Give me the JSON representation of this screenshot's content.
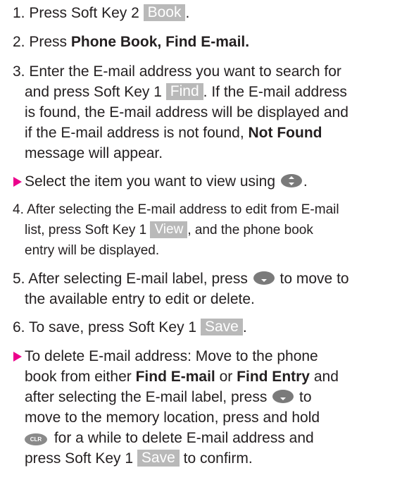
{
  "steps": {
    "s1": {
      "num": "1.",
      "pre": "Press Soft Key 2",
      "key": "Book",
      "post": "."
    },
    "s2": {
      "num": "2.",
      "pre": "Press",
      "bold": "Phone Book, Find E-mail."
    },
    "s3": {
      "num": "3.",
      "l1": "Enter the E-mail address you want to search for",
      "l2_pre": "and press Soft Key 1",
      "key": "Find",
      "l2_post": ". If the E-mail address",
      "l3": "is found, the E-mail address will be displayed and",
      "l4_pre": "if the E-mail address is not found,",
      "l4_bold": "Not Found",
      "l5": "message will appear."
    },
    "b1": {
      "text": "Select the item you want to view using",
      "icon": "navigation-up-down-icon",
      "post": "."
    },
    "s4": {
      "num": "4.",
      "l1": "After selecting the E-mail address to edit from E-mail",
      "l2_pre": "list, press Soft Key 1",
      "key": "View",
      "l2_post": ", and the phone book",
      "l3": "entry will be displayed."
    },
    "s5": {
      "num": "5.",
      "l1_pre": "After selecting E-mail label, press",
      "icon": "navigation-down-icon",
      "l1_post": "to move to",
      "l2": "the available entry to edit or delete."
    },
    "s6": {
      "num": "6.",
      "pre": "To save, press Soft Key 1",
      "key": "Save",
      "post": "."
    },
    "b2": {
      "l1": "To delete E-mail address: Move to the phone",
      "l2_pre": "book from either",
      "l2_bold1": "Find E-mail",
      "l2_mid": "or",
      "l2_bold2": "Find Entry",
      "l2_post": "and",
      "l3_pre": "after selecting the E-mail label, press",
      "l3_post": "to",
      "l4": "move to the memory location, press and hold",
      "clr_label": "CLR",
      "l5_post": "for a while to delete E-mail address and",
      "l6_pre": "press Soft Key 1",
      "key": "Save",
      "l6_post": "to confirm."
    }
  },
  "colors": {
    "softkey_bg": "#b9b9b9",
    "bullet": "#ec008c",
    "text": "#231f20"
  }
}
